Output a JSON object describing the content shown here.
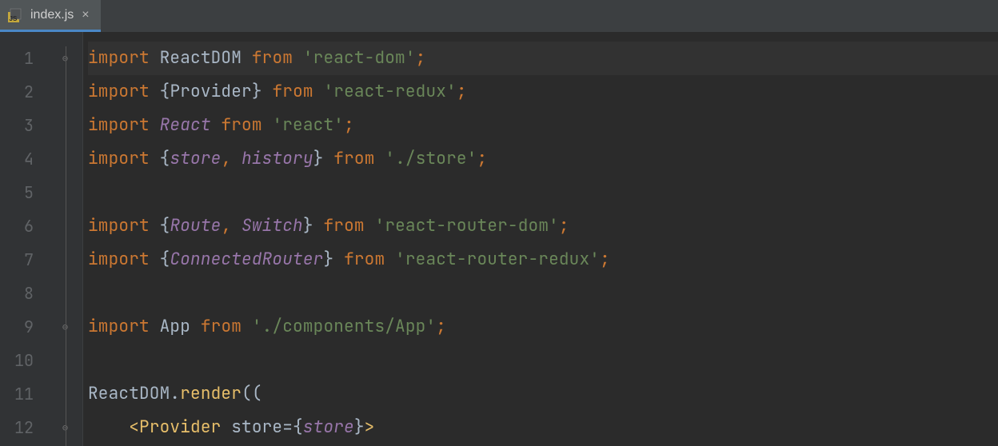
{
  "tab": {
    "filename": "index.js",
    "icon_label": "JS"
  },
  "gutter": {
    "numbers": [
      "1",
      "2",
      "3",
      "4",
      "5",
      "6",
      "7",
      "8",
      "9",
      "10",
      "11",
      "12"
    ]
  },
  "code": {
    "l1": {
      "kw": "import",
      "id": "ReactDOM",
      "from": "from",
      "str": "'react-dom'",
      "semi": ";"
    },
    "l2": {
      "kw": "import",
      "lb": "{",
      "id": "Provider",
      "rb": "}",
      "from": "from",
      "str": "'react-redux'",
      "semi": ";"
    },
    "l3": {
      "kw": "import",
      "id": "React",
      "from": "from",
      "str": "'react'",
      "semi": ";"
    },
    "l4": {
      "kw": "import",
      "lb": "{",
      "id1": "store",
      "comma": ",",
      "id2": "history",
      "rb": "}",
      "from": "from",
      "str": "'./store'",
      "semi": ";"
    },
    "l6": {
      "kw": "import",
      "lb": "{",
      "id1": "Route",
      "comma": ",",
      "id2": "Switch",
      "rb": "}",
      "from": "from",
      "str": "'react-router-dom'",
      "semi": ";"
    },
    "l7": {
      "kw": "import",
      "lb": "{",
      "id": "ConnectedRouter",
      "rb": "}",
      "from": "from",
      "str": "'react-router-redux'",
      "semi": ";"
    },
    "l9": {
      "kw": "import",
      "id": "App",
      "from": "from",
      "str": "'./components/App'",
      "semi": ";"
    },
    "l11": {
      "obj": "ReactDOM",
      "dot": ".",
      "method": "render",
      "paren": "(("
    },
    "l12": {
      "lt": "<",
      "tag": "Provider",
      "attr": "store",
      "eq": "=",
      "lb": "{",
      "val": "store",
      "rb": "}",
      "gt": ">"
    }
  }
}
